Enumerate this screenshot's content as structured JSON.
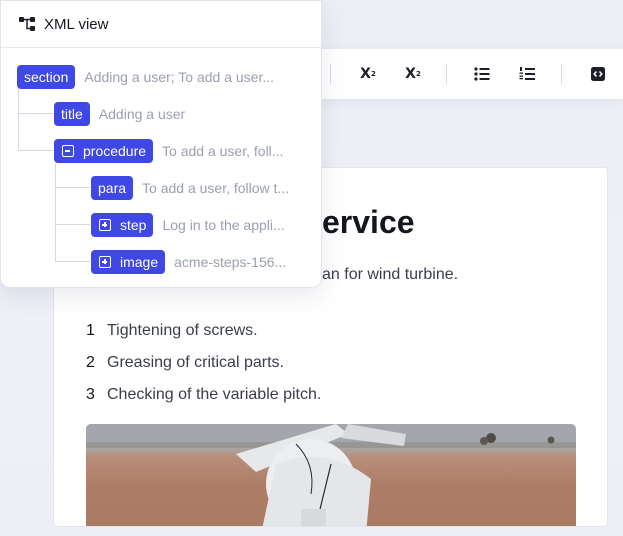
{
  "xml_panel": {
    "title": "XML view",
    "nodes": [
      {
        "tag": "section",
        "preview": "Adding a user; To add a user..."
      },
      {
        "tag": "title",
        "preview": "Adding a user"
      },
      {
        "tag": "procedure",
        "preview": "To add a user, foll...",
        "toggle": "collapse"
      },
      {
        "tag": "para",
        "preview": "To add a user, follow t..."
      },
      {
        "tag": "step",
        "preview": "Log in to the appli...",
        "toggle": "expand"
      },
      {
        "tag": "image",
        "preview": "acme-steps-156...",
        "toggle": "expand"
      }
    ]
  },
  "toolbar": {
    "superscript": "X",
    "superscript_mark": "2",
    "subscript": "X",
    "subscript_mark": "2"
  },
  "document": {
    "title": "ervice",
    "intro": "an for wind turbine.",
    "list": [
      {
        "num": "1",
        "text": "Tightening of screws."
      },
      {
        "num": "2",
        "text": "Greasing of critical parts."
      },
      {
        "num": "3",
        "text": "Checking of the variable pitch."
      }
    ]
  }
}
